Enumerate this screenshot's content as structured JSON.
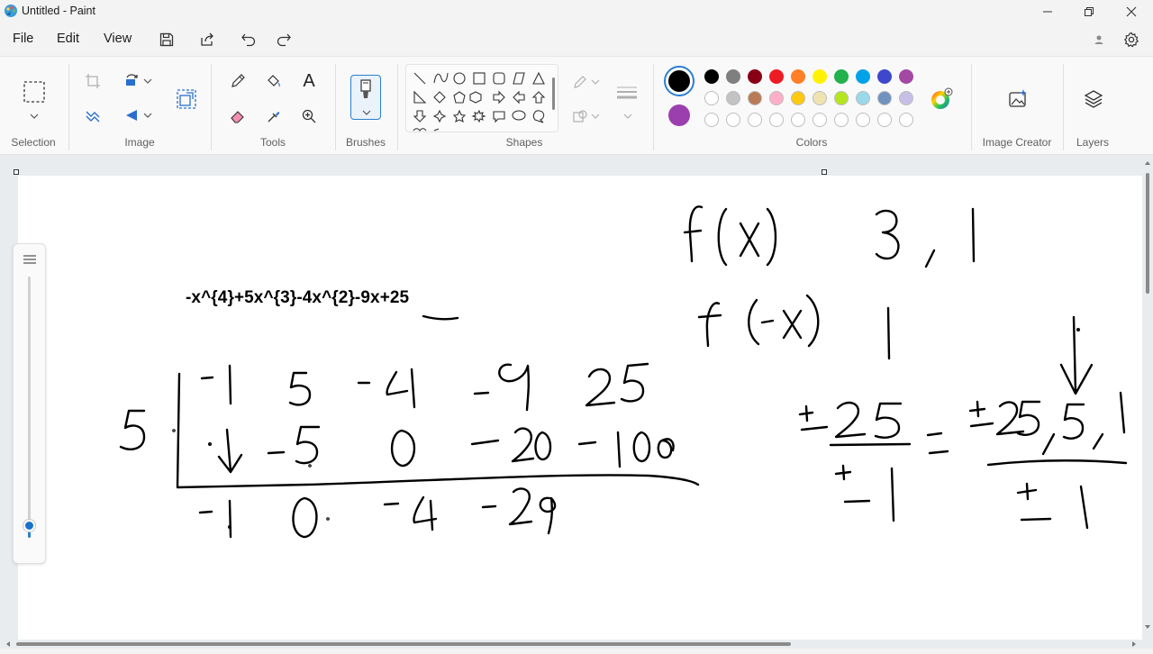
{
  "window": {
    "title": "Untitled - Paint"
  },
  "menu": {
    "file": "File",
    "edit": "Edit",
    "view": "View"
  },
  "ribbon": {
    "groups": {
      "selection": "Selection",
      "image": "Image",
      "tools": "Tools",
      "brushes": "Brushes",
      "shapes": "Shapes",
      "colors": "Colors",
      "image_creator": "Image Creator",
      "layers": "Layers"
    },
    "tools": {
      "text_tool": "A"
    },
    "colors": {
      "primary": "#000000",
      "secondary": "#9c3fae",
      "row1": [
        "#000000",
        "#7f7f7f",
        "#880015",
        "#ed1c24",
        "#ff7f27",
        "#fff200",
        "#22b14c",
        "#00a2e8",
        "#3f48cc",
        "#a349a4"
      ],
      "row2": [
        "#ffffff",
        "#c3c3c3",
        "#b97a57",
        "#ffaec9",
        "#ffc90e",
        "#efe4b0",
        "#b5e61d",
        "#99d9ea",
        "#7092be",
        "#c8bfe7"
      ],
      "row3": [
        "#ffffff",
        "#ffffff",
        "#ffffff",
        "#ffffff",
        "#ffffff",
        "#ffffff",
        "#ffffff",
        "#ffffff",
        "#ffffff",
        "#ffffff"
      ]
    }
  },
  "canvas": {
    "equation_text": "-x^{4}+5x^{3}-4x^{2}-9x+25"
  },
  "zoom": {
    "level_fraction": 0.95
  }
}
